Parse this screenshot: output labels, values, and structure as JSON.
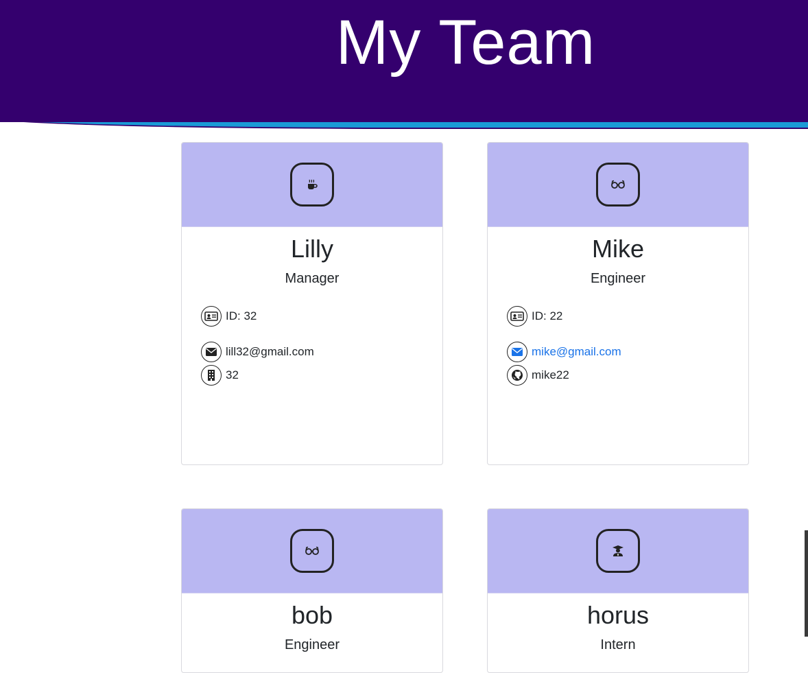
{
  "header": {
    "title": "My Team"
  },
  "colors": {
    "header_bg": "#34006e",
    "accent_wave": "#1a9ad6",
    "card_top": "#b9b7f2",
    "link": "#1a73e8"
  },
  "cards": [
    {
      "name": "Lilly",
      "role": "Manager",
      "role_icon": "coffee-icon",
      "id_text": "ID: 32",
      "email": "lill32@gmail.com",
      "extra_icon": "building-icon",
      "extra": "32"
    },
    {
      "name": "Mike",
      "role": "Engineer",
      "role_icon": "glasses-icon",
      "id_text": "ID: 22",
      "email": "mike@gmail.com",
      "extra_icon": "github-icon",
      "extra": "mike22"
    },
    {
      "name": "bob",
      "role": "Engineer",
      "role_icon": "glasses-icon"
    },
    {
      "name": "horus",
      "role": "Intern",
      "role_icon": "graduate-icon"
    }
  ]
}
